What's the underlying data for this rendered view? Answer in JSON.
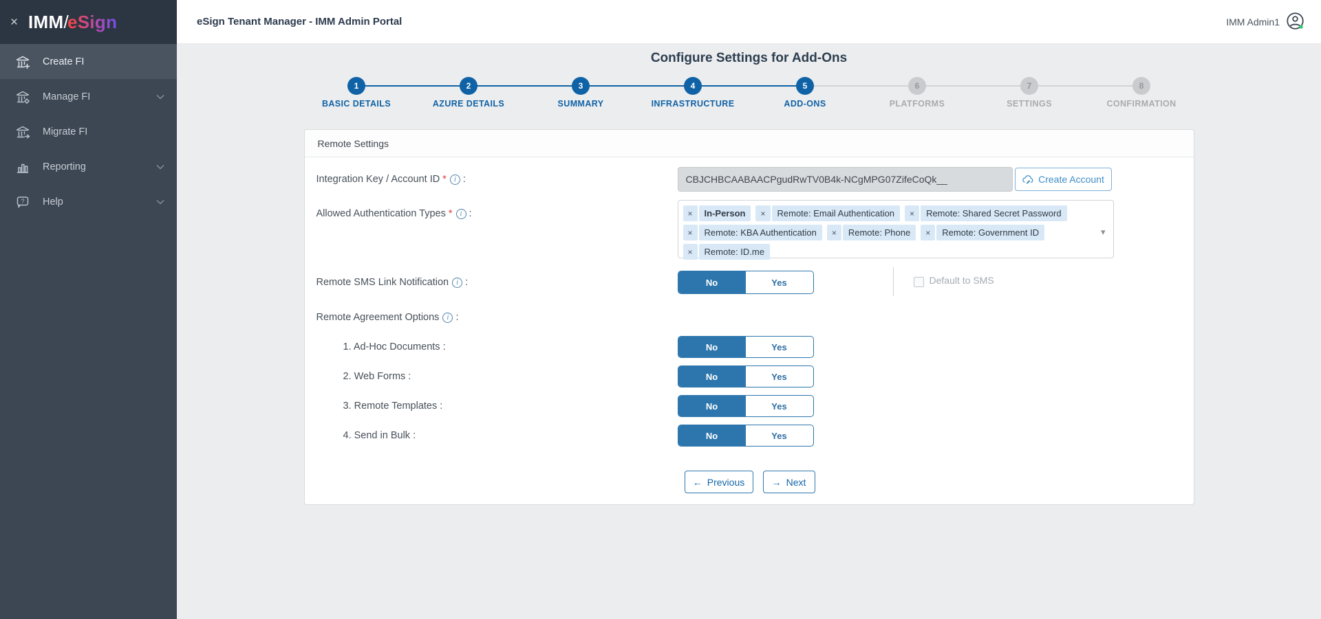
{
  "icons": {
    "close": "×",
    "remove": "×",
    "caret": "▾",
    "arrow_left": "←",
    "arrow_right": "→",
    "info": "i",
    "required": "*"
  },
  "logo": {
    "imm": "IMM",
    "slash": "/",
    "esign": "eSign"
  },
  "sidebar": {
    "items": [
      {
        "label": "Create FI"
      },
      {
        "label": "Manage FI"
      },
      {
        "label": "Migrate FI"
      },
      {
        "label": "Reporting"
      },
      {
        "label": "Help"
      }
    ]
  },
  "header": {
    "title": "eSign Tenant Manager - IMM Admin Portal",
    "user": "IMM Admin1"
  },
  "page": {
    "title": "Configure Settings for Add-Ons"
  },
  "stepper": {
    "steps": [
      {
        "num": "1",
        "label": "BASIC DETAILS",
        "state": "done"
      },
      {
        "num": "2",
        "label": "AZURE DETAILS",
        "state": "done"
      },
      {
        "num": "3",
        "label": "SUMMARY",
        "state": "done"
      },
      {
        "num": "4",
        "label": "INFRASTRUCTURE",
        "state": "done"
      },
      {
        "num": "5",
        "label": "ADD-ONS",
        "state": "active"
      },
      {
        "num": "6",
        "label": "PLATFORMS",
        "state": "pending"
      },
      {
        "num": "7",
        "label": "SETTINGS",
        "state": "pending"
      },
      {
        "num": "8",
        "label": "CONFIRMATION",
        "state": "pending"
      }
    ]
  },
  "panel": {
    "title": "Remote Settings",
    "label_suffix": ":",
    "integration": {
      "label": "Integration Key / Account ID",
      "value": "CBJCHBCAABAACPgudRwTV0B4k-NCgMPG07ZifeCoQk__",
      "button": "Create Account"
    },
    "auth": {
      "label": "Allowed Authentication Types",
      "tags": [
        "In-Person",
        "Remote: Email Authentication",
        "Remote: Shared Secret Password",
        "Remote: KBA Authentication",
        "Remote: Phone",
        "Remote: Government ID",
        "Remote: ID.me"
      ]
    },
    "sms": {
      "label": "Remote SMS Link Notification",
      "no": "No",
      "yes": "Yes",
      "selected": "No",
      "checkbox": "Default to SMS"
    },
    "agreement": {
      "label": "Remote Agreement Options",
      "options": [
        {
          "label": "1. Ad-Hoc Documents :",
          "no": "No",
          "yes": "Yes",
          "selected": "No"
        },
        {
          "label": "2. Web Forms :",
          "no": "No",
          "yes": "Yes",
          "selected": "No"
        },
        {
          "label": "3. Remote Templates :",
          "no": "No",
          "yes": "Yes",
          "selected": "No"
        },
        {
          "label": "4. Send in Bulk :",
          "no": "No",
          "yes": "Yes",
          "selected": "No"
        }
      ]
    },
    "nav": {
      "previous": "Previous",
      "next": "Next"
    }
  },
  "colors": {
    "accent_blue": "#0f62a5",
    "toggle_blue": "#2d76ad",
    "sidebar_bg": "#3d4653",
    "logo_band_bg": "#2c3542",
    "tag_bg": "#d9e8f7",
    "logo_gradient_start": "#f0454d",
    "logo_gradient_end": "#7a4ee0",
    "status_green": "#2ecc71",
    "required_red": "#e03c31"
  }
}
